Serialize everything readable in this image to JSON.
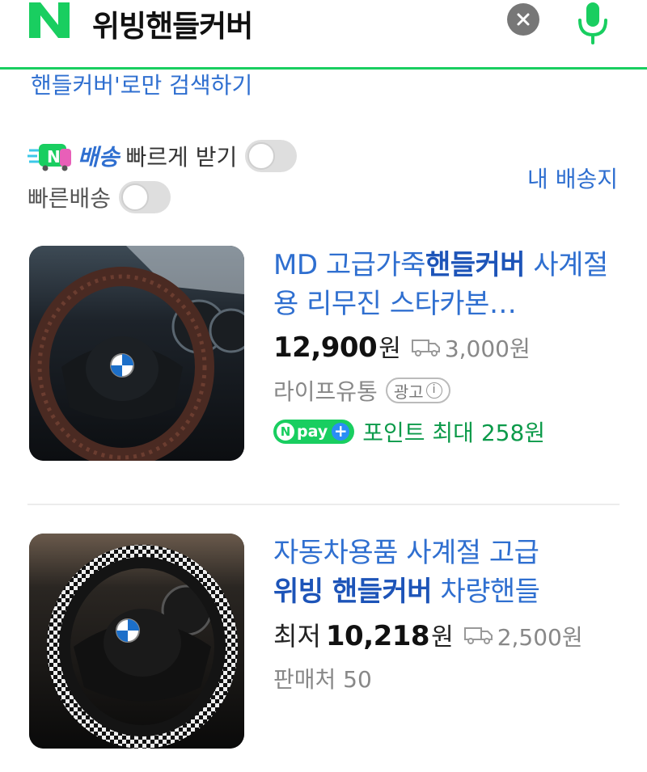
{
  "header": {
    "logo_letter": "N",
    "query": "위빙핸들커버"
  },
  "only_search": "핸들커버'로만 검색하기",
  "filters": {
    "npay_delivery_word": "배송",
    "fast_receive_label": "빠르게 받기",
    "fast_delivery_label": "빠른배송",
    "my_delivery_link": "내 배송지"
  },
  "products": [
    {
      "title_prefix": "MD 고급가죽",
      "title_highlight": "핸들커버",
      "title_suffix": " 사계절용 리무진 스타카본…",
      "price": "12,900",
      "currency": "원",
      "shipping_fee": "3,000원",
      "seller": "라이프유통",
      "ad_label": "광고",
      "npay_text": "pay",
      "point_text": "포인트 최대 258원"
    },
    {
      "title_line1": "자동차용품 사계절 고급",
      "title_highlight": "위빙 핸들커버",
      "title_suffix": " 차량핸들",
      "price_prefix": "최저",
      "price": "10,218",
      "currency": "원",
      "shipping_fee": "2,500원",
      "seller_count": "판매처 50"
    }
  ],
  "colors": {
    "naver_green": "#19ce60",
    "link_blue": "#2f6fd0",
    "point_green": "#0c9a4a"
  }
}
